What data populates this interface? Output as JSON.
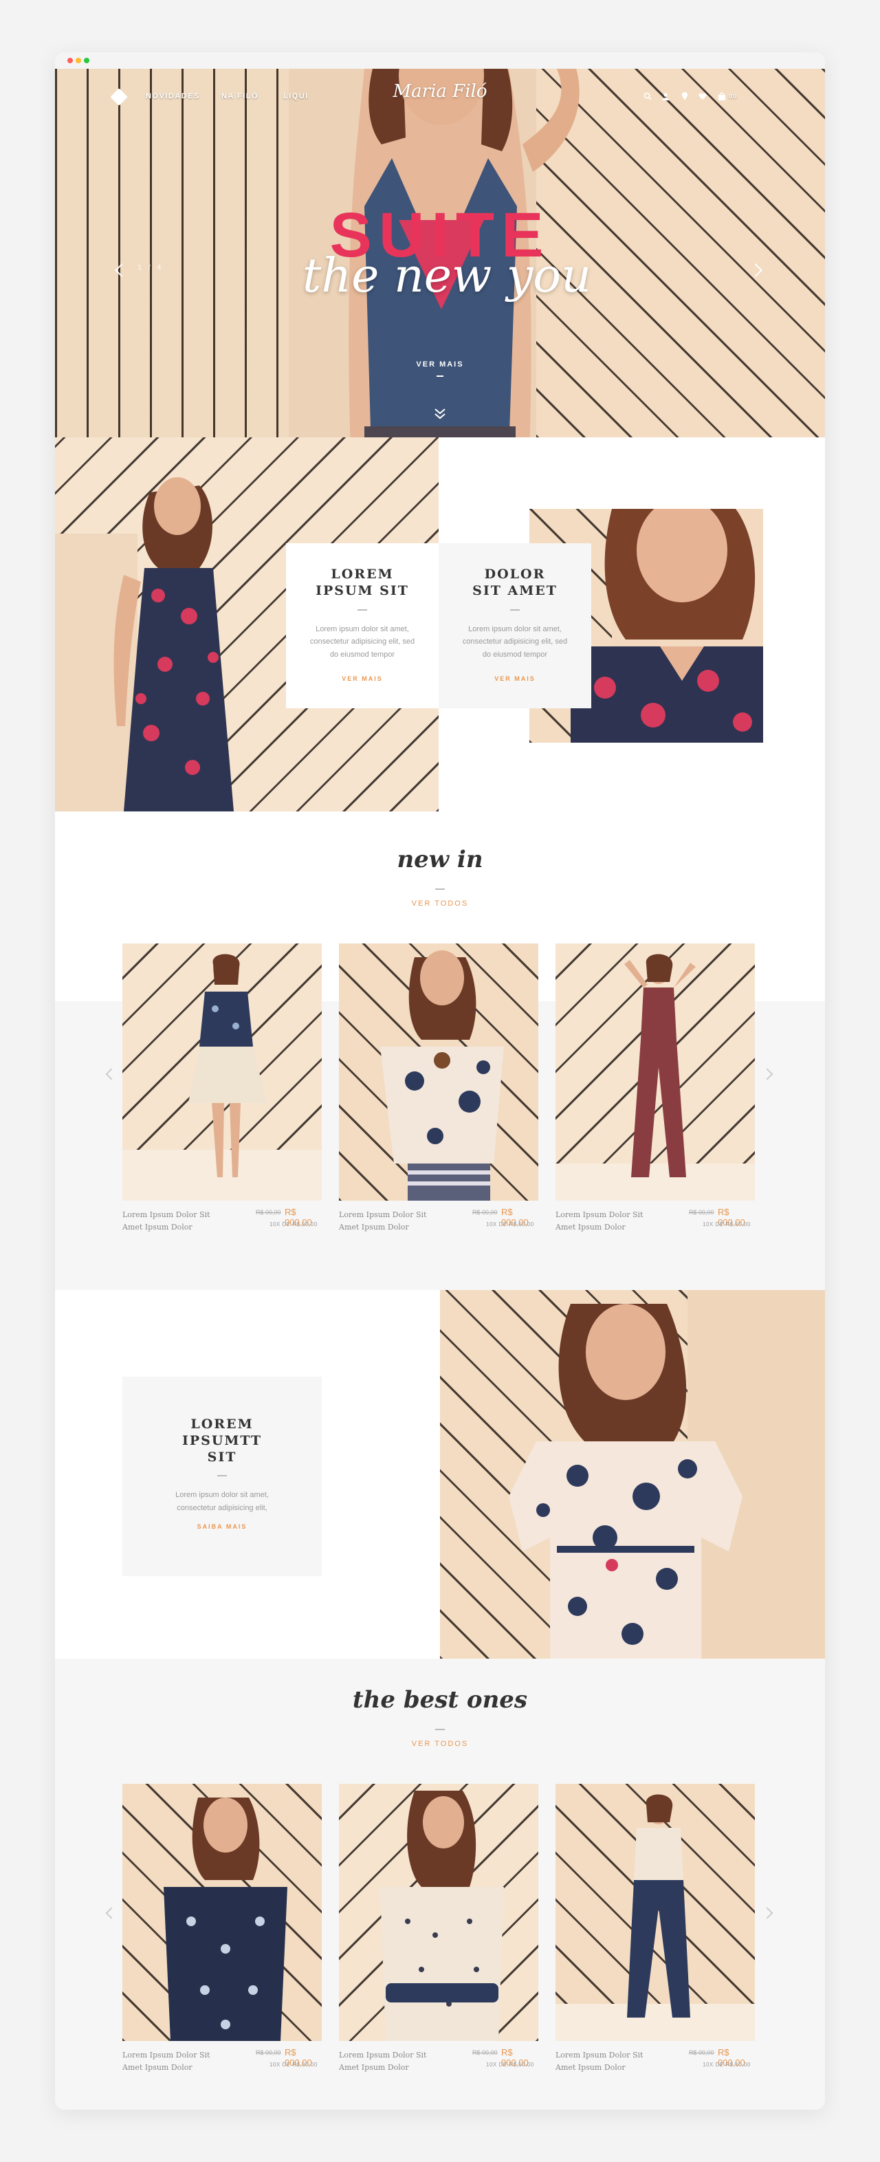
{
  "header": {
    "brand": "Maria Filó",
    "nav": [
      "NOVIDADES",
      "NA FILÓ",
      "LIQUI"
    ],
    "bag_count": "00"
  },
  "hero": {
    "slide": "1 / 4",
    "title": "SUITE",
    "script": "the new you",
    "cta": "VER MAIS",
    "cta_dots": "•••"
  },
  "editorial": {
    "cards": [
      {
        "title": "LOREM\nIPSUM SIT",
        "text": "Lorem ipsum dolor sit amet, consectetur adipisicing elit, sed do eiusmod tempor",
        "link": "VER MAIS"
      },
      {
        "title": "DOLOR\nSIT AMET",
        "text": "Lorem ipsum dolor sit amet, consectetur adipisicing elit, sed do eiusmod tempor",
        "link": "VER MAIS"
      }
    ]
  },
  "new_in": {
    "title": "new in",
    "link": "VER TODOS",
    "products": [
      {
        "name": "Lorem Ipsum Dolor Sit Amet Ipsum Dolor",
        "old_price": "R$ 00,00",
        "price": "R$ 000,00",
        "installments": "10X DE R$ 00,00"
      },
      {
        "name": "Lorem Ipsum Dolor Sit Amet Ipsum Dolor",
        "old_price": "R$ 00,00",
        "price": "R$ 000,00",
        "installments": "10X DE R$ 00,00"
      },
      {
        "name": "Lorem Ipsum Dolor Sit Amet Ipsum Dolor",
        "old_price": "R$ 00,00",
        "price": "R$ 000,00",
        "installments": "10X DE R$ 00,00"
      }
    ]
  },
  "editorial2": {
    "title": "LOREM\nIPSUMTT\nSIT",
    "text": "Lorem ipsum dolor sit amet, consectetur adipisicing elit,",
    "link": "SAIBA MAIS"
  },
  "best": {
    "title": "the best ones",
    "link": "VER TODOS",
    "products": [
      {
        "name": "Lorem Ipsum Dolor Sit Amet Ipsum Dolor",
        "old_price": "R$ 00,00",
        "price": "R$ 000,00",
        "installments": "10X DE R$ 00,00"
      },
      {
        "name": "Lorem Ipsum Dolor Sit Amet Ipsum Dolor",
        "old_price": "R$ 00,00",
        "price": "R$ 000,00",
        "installments": "10X DE R$ 00,00"
      },
      {
        "name": "Lorem Ipsum Dolor Sit Amet Ipsum Dolor",
        "old_price": "R$ 00,00",
        "price": "R$ 000,00",
        "installments": "10X DE R$ 00,00"
      }
    ]
  },
  "icons": [
    "menu-diamond-icon",
    "search-icon",
    "user-icon",
    "location-icon",
    "heart-icon",
    "bag-icon",
    "arrow-left-icon",
    "arrow-right-icon",
    "chevron-down-icon"
  ],
  "colors": {
    "accent": "#e8964f",
    "hero_title": "#e8345a",
    "panel_bg": "#f6f6f6"
  }
}
